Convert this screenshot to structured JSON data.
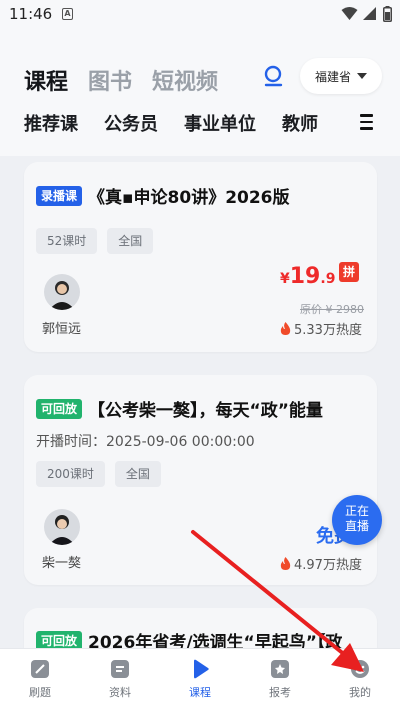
{
  "status_bar": {
    "time": "11:46",
    "notif_letter": "A"
  },
  "header": {
    "tabs": [
      {
        "label": "课程",
        "active": true
      },
      {
        "label": "图书",
        "active": false
      },
      {
        "label": "短视频",
        "active": false
      }
    ],
    "province": "福建省",
    "categories": [
      "推荐课",
      "公务员",
      "事业单位",
      "教师"
    ]
  },
  "cards": [
    {
      "badge": "录播课",
      "title": "《真▪申论80讲》2026版",
      "tags": [
        "52课时",
        "全国"
      ],
      "teacher": "郭恒远",
      "price": {
        "currency": "¥",
        "integer": "19",
        "decimal": ".9"
      },
      "group_badge": "拼",
      "original_price": "原价 ¥ 2980",
      "heat": "5.33万热度"
    },
    {
      "badge": "可回放",
      "title": "【公考柴一獒】，每天“政”能量",
      "start_time": "开播时间：2025-09-06 00:00:00",
      "tags": [
        "200课时",
        "全国"
      ],
      "teacher": "柴一獒",
      "free_label": "免费",
      "heat": "4.97万热度"
    },
    {
      "badge": "可回放",
      "title": "2026年省考/选调生“早起鸟”【政"
    }
  ],
  "live_float": {
    "line1": "正在",
    "line2": "直播"
  },
  "bottom_nav": [
    {
      "label": "刷题",
      "active": false
    },
    {
      "label": "资料",
      "active": false
    },
    {
      "label": "课程",
      "active": true
    },
    {
      "label": "报考",
      "active": false
    },
    {
      "label": "我的",
      "active": false
    }
  ],
  "colors": {
    "accent": "#2461e8",
    "price": "#ee2a2a",
    "live_badge": "#21b36d",
    "arrow": "#e82020"
  }
}
